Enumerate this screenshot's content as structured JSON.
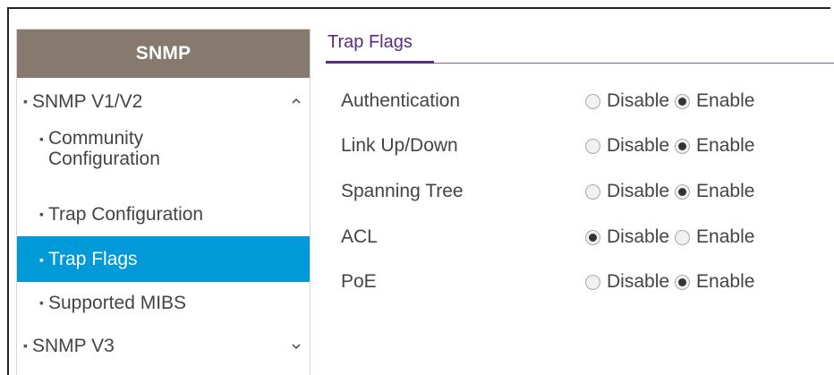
{
  "sidebar": {
    "header": "SNMP",
    "items": [
      {
        "label": "SNMP V1/V2",
        "level": "top",
        "chevron": "up"
      },
      {
        "label": "Community Configuration",
        "level": "sub"
      },
      {
        "label": "Trap Configuration",
        "level": "sub"
      },
      {
        "label": "Trap Flags",
        "level": "sub",
        "active": true
      },
      {
        "label": "Supported MIBS",
        "level": "sub"
      },
      {
        "label": "SNMP V3",
        "level": "top",
        "chevron": "down"
      }
    ],
    "community_line1": "Community",
    "community_line2": "Configuration",
    "bullet": "▪"
  },
  "main": {
    "tab_label": "Trap Flags",
    "options": {
      "disable": "Disable",
      "enable": "Enable"
    },
    "flags": [
      {
        "name": "Authentication",
        "selected": "enable"
      },
      {
        "name": "Link Up/Down",
        "selected": "enable"
      },
      {
        "name": "Spanning Tree",
        "selected": "enable"
      },
      {
        "name": "ACL",
        "selected": "disable"
      },
      {
        "name": "PoE",
        "selected": "enable"
      }
    ]
  },
  "colors": {
    "sidebar_header": "#86796d",
    "active_item": "#009ad9",
    "tab_accent": "#5b2a86"
  }
}
